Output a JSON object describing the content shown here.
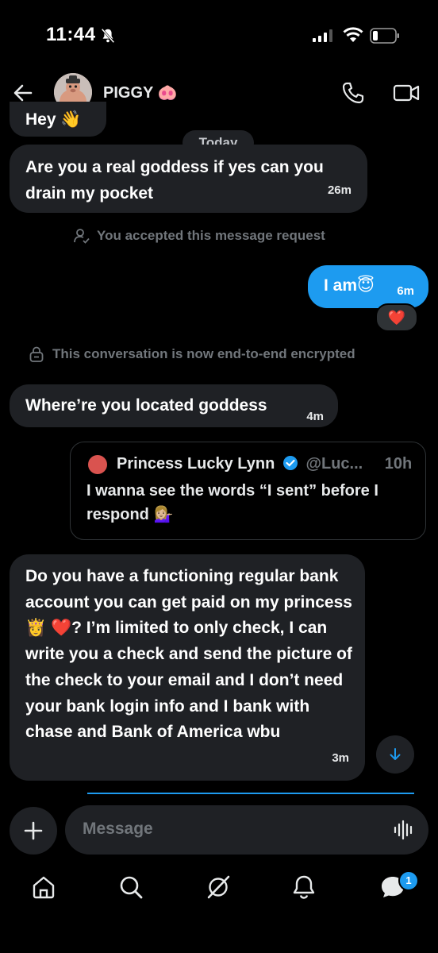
{
  "status_bar": {
    "time": "11:44"
  },
  "header": {
    "contact_name": "PIGGY 🐽"
  },
  "conversation": {
    "previous_message_fragment": "Hey 👋",
    "date_divider": "Today",
    "messages": [
      {
        "direction": "incoming",
        "text": "Are you a real goddess if yes can you drain my pocket",
        "time": "26m"
      },
      {
        "direction": "outgoing",
        "text": "I am😇",
        "time": "6m",
        "reaction": "❤️"
      },
      {
        "direction": "incoming",
        "text": "Where’re you located goddess",
        "time": "4m"
      },
      {
        "direction": "incoming",
        "text": "Do you have a functioning regular bank account you can get paid on my princess 👸 ❤️? I’m limited to only check, I can write you a check and send the picture of the check to your email and I don’t need your bank login info and I bank with chase and Bank of America wbu",
        "time": "3m"
      }
    ],
    "system_notices": {
      "accepted": "You accepted this message request",
      "encrypted": "This conversation is now end-to-end encrypted"
    },
    "quoted_post": {
      "author": "Princess Lucky Lynn",
      "handle": "@Luc...",
      "time": "10h",
      "text": "I wanna see the words “I sent” before I respond 💁🏼‍♀️"
    }
  },
  "composer": {
    "placeholder": "Message"
  },
  "bottom_nav": {
    "items": [
      "home",
      "search",
      "grok",
      "notifications",
      "messages"
    ],
    "messages_badge": "1"
  },
  "colors": {
    "accent": "#1d9bf0",
    "bubble_in": "#1f2125",
    "background": "#000000"
  }
}
